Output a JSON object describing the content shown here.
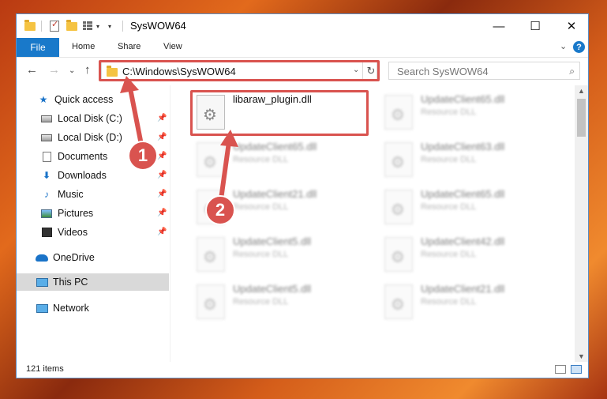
{
  "window": {
    "title": "SysWOW64",
    "controls": {
      "minimize": "—",
      "maximize": "☐",
      "close": "✕"
    }
  },
  "ribbon": {
    "tabs": [
      "File",
      "Home",
      "Share",
      "View"
    ],
    "collapse_glyph": "⌄",
    "help_glyph": "?"
  },
  "address": {
    "back_glyph": "←",
    "forward_glyph": "→",
    "recent_glyph": "⌄",
    "up_glyph": "↑",
    "path": "C:\\Windows\\SysWOW64",
    "dropdown_glyph": "⌄",
    "refresh_glyph": "↻",
    "search_placeholder": "Search SysWOW64",
    "search_glyph": "⌕"
  },
  "navpane": {
    "items": [
      {
        "label": "Quick access",
        "icon": "star-icon",
        "pinned": false
      },
      {
        "label": "Local Disk (C:)",
        "icon": "disk-icon",
        "pinned": true
      },
      {
        "label": "Local Disk (D:)",
        "icon": "disk-icon",
        "pinned": true
      },
      {
        "label": "Documents",
        "icon": "documents-icon",
        "pinned": true
      },
      {
        "label": "Downloads",
        "icon": "download-icon",
        "pinned": true
      },
      {
        "label": "Music",
        "icon": "music-icon",
        "pinned": true
      },
      {
        "label": "Pictures",
        "icon": "pictures-icon",
        "pinned": true
      },
      {
        "label": "Videos",
        "icon": "videos-icon",
        "pinned": true
      },
      {
        "label": "OneDrive",
        "icon": "cloud-icon",
        "pinned": false
      },
      {
        "label": "This PC",
        "icon": "pc-icon",
        "pinned": false,
        "selected": true
      },
      {
        "label": "Network",
        "icon": "network-icon",
        "pinned": false
      }
    ],
    "pin_glyph": "📌"
  },
  "files": {
    "highlighted": {
      "name": "libaraw_plugin.dll",
      "type": ""
    },
    "left_column": [
      {
        "name": "UpdateClient65.dll",
        "type": "Resource DLL"
      },
      {
        "name": "UpdateClient21.dll",
        "type": "Resource DLL"
      },
      {
        "name": "UpdateClient5.dll",
        "type": "Resource DLL"
      },
      {
        "name": "UpdateClient5.dll",
        "type": "Resource DLL"
      }
    ],
    "right_column": [
      {
        "name": "UpdateClient65.dll",
        "type": "Resource DLL"
      },
      {
        "name": "UpdateClient63.dll",
        "type": "Resource DLL"
      },
      {
        "name": "UpdateClient65.dll",
        "type": "Resource DLL"
      },
      {
        "name": "UpdateClient42.dll",
        "type": "Resource DLL"
      },
      {
        "name": "UpdateClient21.dll",
        "type": "Resource DLL"
      }
    ]
  },
  "status": {
    "item_count": "121 items"
  },
  "annotations": {
    "step1": "1",
    "step2": "2",
    "color": "#d9534f"
  }
}
